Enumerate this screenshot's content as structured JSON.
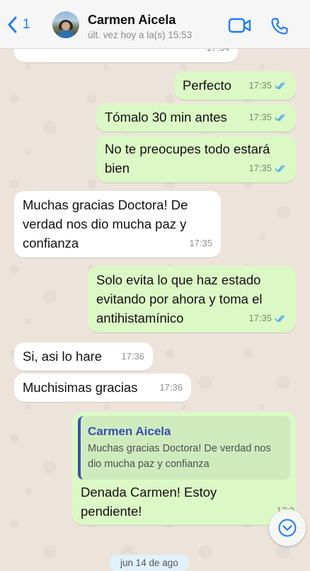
{
  "header": {
    "back_count": "1",
    "contact_name": "Carmen Aicela",
    "last_seen": "últ. vez hoy a la(s) 15:53"
  },
  "messages": [
    {
      "direction": "in",
      "text": "",
      "time": "17:34"
    },
    {
      "direction": "out",
      "text": "Perfecto",
      "time": "17:35",
      "read": true
    },
    {
      "direction": "out",
      "text": "Tómalo 30 min antes",
      "time": "17:35",
      "read": true
    },
    {
      "direction": "out",
      "text": "No te preocupes todo estará bien",
      "time": "17:35",
      "read": true
    },
    {
      "direction": "in",
      "text": "Muchas gracias Doctora! De verdad nos dio mucha paz y confianza",
      "time": "17:35"
    },
    {
      "direction": "out",
      "text": "Solo evita lo que haz estado evitando por ahora y toma el antihistamínico",
      "time": "17:35",
      "read": true
    },
    {
      "direction": "in",
      "text": "Si, asi lo hare",
      "time": "17:36"
    },
    {
      "direction": "in",
      "text": "Muchisimas gracias",
      "time": "17:36"
    },
    {
      "direction": "out",
      "reply_to": {
        "name": "Carmen Aicela",
        "text": "Muchas gracias Doctora! De verdad nos dio mucha paz y confianza"
      },
      "text": "Denada Carmen! Estoy pendiente!",
      "time": "17:3"
    }
  ],
  "date_separator": "jun 14 de ago",
  "colors": {
    "accent": "#1F7BF6",
    "outgoing_bubble": "#DCF8C6",
    "incoming_bubble": "#FFFFFF",
    "read_ticks": "#4FA6E8",
    "quote_name": "#3A4FB2"
  },
  "icons": {
    "back": "chevron-left-icon",
    "video": "video-camera-icon",
    "call": "phone-icon",
    "scroll_down": "chevron-down-circle-icon",
    "read_status": "double-check-icon"
  }
}
